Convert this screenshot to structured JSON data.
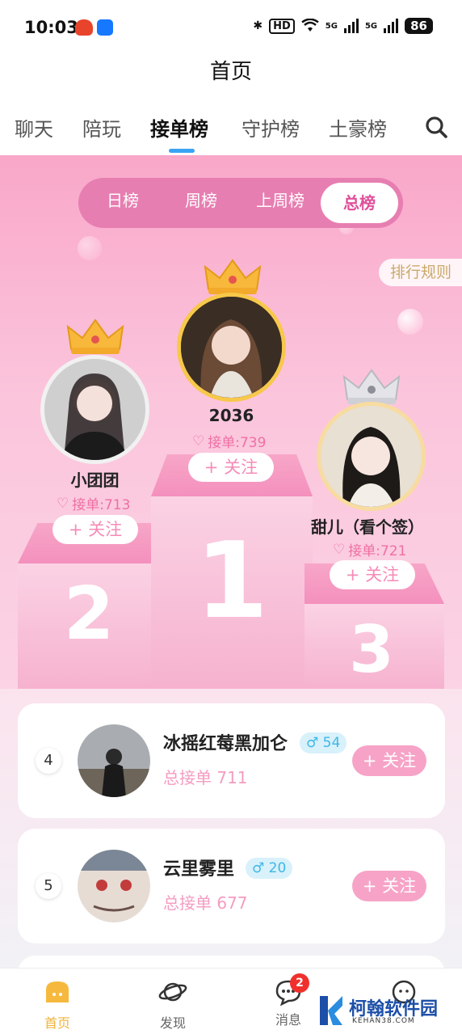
{
  "status_bar": {
    "time": "10:03",
    "hd": "HD",
    "signal1": "5G",
    "signal2": "5G",
    "battery": "86"
  },
  "header": {
    "title": "首页"
  },
  "tabs": [
    {
      "label": "聊天"
    },
    {
      "label": "陪玩"
    },
    {
      "label": "接单榜"
    },
    {
      "label": "守护榜"
    },
    {
      "label": "土豪榜"
    }
  ],
  "active_tab": "接单榜",
  "period_selector": {
    "items": [
      "日榜",
      "周榜",
      "上周榜",
      "总榜"
    ],
    "active": "总榜"
  },
  "rules_button": "排行规则",
  "podium": [
    {
      "rank": "1",
      "name": "2036",
      "orders": "接单:739",
      "follow": "+ 关注"
    },
    {
      "rank": "2",
      "name": "小团团",
      "orders": "接单:713",
      "follow": "+ 关注"
    },
    {
      "rank": "3",
      "name": "甜儿（看个签）",
      "orders": "接单:721",
      "follow": "+ 关注"
    }
  ],
  "list": [
    {
      "rank": "4",
      "name": "冰摇红莓黑加仑",
      "gender_badge": "♂ 54",
      "orders": "总接单 711",
      "follow": "+ 关注"
    },
    {
      "rank": "5",
      "name": "云里雾里",
      "gender_badge": "♂ 20",
      "orders": "总接单 677",
      "follow": "+ 关注"
    }
  ],
  "bottom_nav": [
    {
      "label": "首页",
      "icon": "home-icon"
    },
    {
      "label": "发现",
      "icon": "discover-planet-icon"
    },
    {
      "label": "消息",
      "icon": "message-bubble-icon",
      "badge": "2"
    },
    {
      "label": "",
      "icon": "profile-icon"
    }
  ],
  "watermark": {
    "text": "柯翰软件园",
    "sub": "KEHAN38.COM"
  },
  "colors": {
    "accent_pink": "#e77eb1",
    "tab_underline": "#3aa3f3",
    "gold": "#f0b33b"
  }
}
